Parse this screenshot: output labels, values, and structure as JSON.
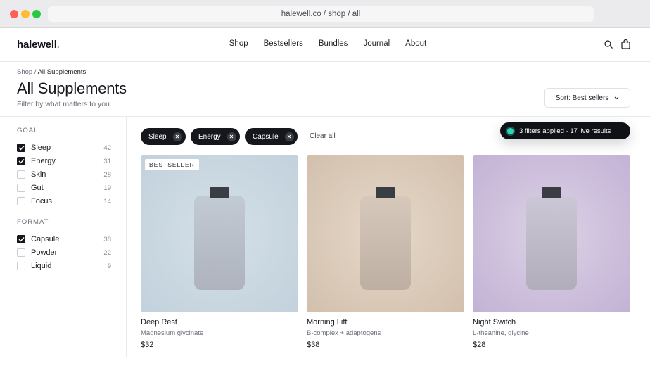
{
  "browser": {
    "url": "halewell.co / shop / all"
  },
  "header": {
    "logo_text": "halewell",
    "logo_dot": ".",
    "nav": [
      "Shop",
      "Bestsellers",
      "Bundles",
      "Journal",
      "About"
    ]
  },
  "page": {
    "breadcrumb_root": "Shop",
    "breadcrumb_sep": "/",
    "breadcrumb_current": "All Supplements",
    "title": "All Supplements",
    "subtitle": "Filter by what matters to you.",
    "sort_label": "Sort: Best sellers"
  },
  "filters": {
    "goal": {
      "title": "GOAL",
      "items": [
        {
          "label": "Sleep",
          "count": "42",
          "checked": true
        },
        {
          "label": "Energy",
          "count": "31",
          "checked": true
        },
        {
          "label": "Skin",
          "count": "28",
          "checked": false
        },
        {
          "label": "Gut",
          "count": "19",
          "checked": false
        },
        {
          "label": "Focus",
          "count": "14",
          "checked": false
        }
      ]
    },
    "format": {
      "title": "FORMAT",
      "items": [
        {
          "label": "Capsule",
          "count": "38",
          "checked": true
        },
        {
          "label": "Powder",
          "count": "22",
          "checked": false
        },
        {
          "label": "Liquid",
          "count": "9",
          "checked": false
        }
      ]
    }
  },
  "active_chips": [
    "Sleep",
    "Energy",
    "Capsule"
  ],
  "clear_all_label": "Clear all",
  "toast": {
    "text": "3 filters applied · 17 live results",
    "accent": "#2fd3b5"
  },
  "products": [
    {
      "name": "Deep Rest",
      "desc": "Magnesium glycinate",
      "price": "$32",
      "badge": "BESTSELLER",
      "bg": "#c8d6e0",
      "bottle": "#bcc5cf"
    },
    {
      "name": "Morning Lift",
      "desc": "B-complex + adaptogens",
      "price": "$38",
      "badge": "",
      "bg": "#d6c5b3",
      "bottle": "#cdbfb0"
    },
    {
      "name": "Night Switch",
      "desc": "L-theanine, glycine",
      "price": "$28",
      "badge": "",
      "bg": "#c8b8d8",
      "bottle": "#c2bdcd"
    }
  ],
  "colors": {
    "ink": "#15171c",
    "muted": "#6b6f78",
    "border": "#e8e9ec"
  }
}
